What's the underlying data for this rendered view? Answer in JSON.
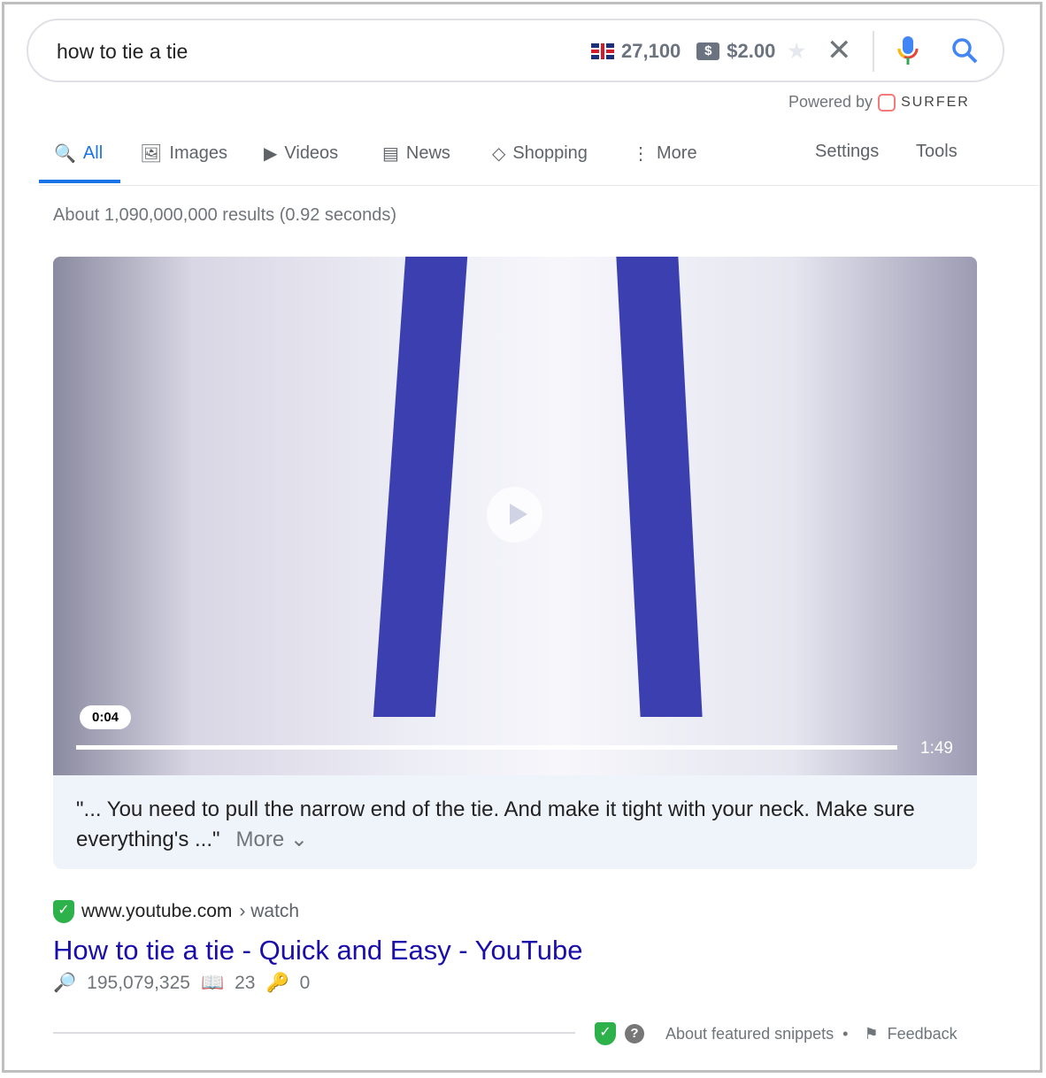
{
  "search": {
    "query": "how to tie a tie",
    "volume": "27,100",
    "cpc": "$2.00"
  },
  "powered": {
    "label": "Powered by",
    "brand": "SURFER"
  },
  "tabs": [
    {
      "label": "All"
    },
    {
      "label": "Images"
    },
    {
      "label": "Videos"
    },
    {
      "label": "News"
    },
    {
      "label": "Shopping"
    },
    {
      "label": "More"
    },
    {
      "label": "Settings"
    },
    {
      "label": "Tools"
    }
  ],
  "stats": "About 1,090,000,000 results (0.92 seconds)",
  "video": {
    "current": "0:04",
    "duration": "1:49",
    "progress": 0.037
  },
  "snippet": {
    "text": "\"... You need to pull the narrow end of the tie. And make it tight with your neck. Make sure everything's ...\"",
    "more": "More"
  },
  "result": {
    "domain": "www.youtube.com",
    "path": "› watch",
    "title": "How to tie a tie - Quick and Easy - YouTube",
    "views": "195,079,325",
    "words": "23",
    "keys": "0"
  },
  "footer": {
    "about": "About featured snippets",
    "feedback": "Feedback"
  },
  "colors": {
    "accent": "#1a73e8",
    "link": "#1a0dab"
  }
}
